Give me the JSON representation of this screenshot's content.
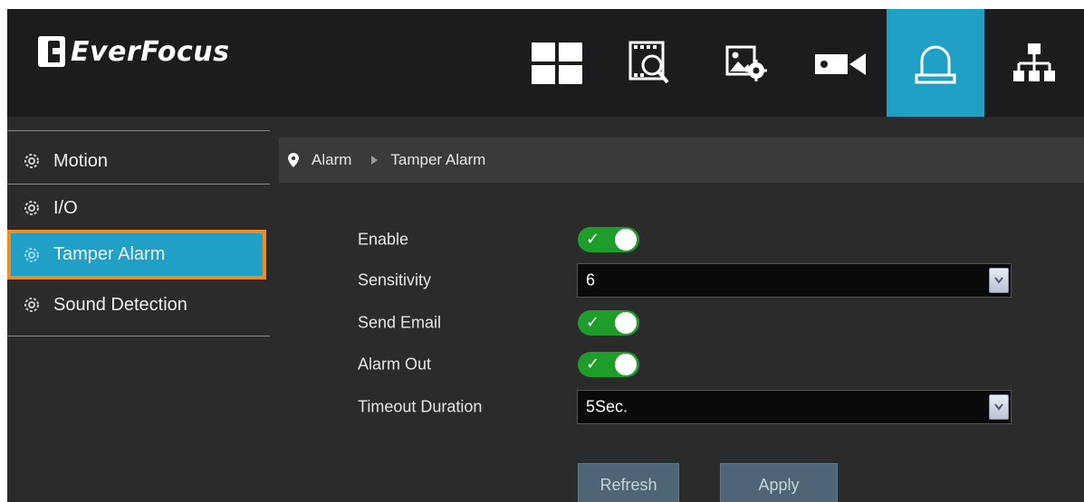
{
  "header": {
    "brand": "EverFocus",
    "nav": [
      {
        "id": "live",
        "icon": "grid-layout-icon",
        "active": false
      },
      {
        "id": "playback",
        "icon": "film-search-icon",
        "active": false
      },
      {
        "id": "image",
        "icon": "image-settings-icon",
        "active": false
      },
      {
        "id": "camera",
        "icon": "video-camera-icon",
        "active": false
      },
      {
        "id": "alarm",
        "icon": "alarm-bell-icon",
        "active": true
      },
      {
        "id": "network",
        "icon": "network-tree-icon",
        "active": false
      }
    ],
    "accent": "#1fa0c4"
  },
  "sidebar": {
    "items": [
      {
        "label": "Motion",
        "icon": "gear-icon",
        "active": false
      },
      {
        "label": "I/O",
        "icon": "gear-icon",
        "active": false
      },
      {
        "label": "Tamper Alarm",
        "icon": "gear-icon",
        "active": true
      },
      {
        "label": "Sound Detection",
        "icon": "gear-icon",
        "active": false
      }
    ],
    "highlight_color": "#f28b22"
  },
  "breadcrumb": {
    "icon": "location-pin-icon",
    "items": [
      "Alarm",
      "Tamper Alarm"
    ]
  },
  "form": {
    "enable": {
      "label": "Enable",
      "checked": true
    },
    "sensitivity": {
      "label": "Sensitivity",
      "value": "6"
    },
    "send_email": {
      "label": "Send Email",
      "checked": true
    },
    "alarm_out": {
      "label": "Alarm Out",
      "checked": true
    },
    "timeout": {
      "label": "Timeout Duration",
      "value": "5Sec."
    },
    "toggle_color": "#1f9d2a"
  },
  "buttons": {
    "refresh": "Refresh",
    "apply": "Apply"
  }
}
